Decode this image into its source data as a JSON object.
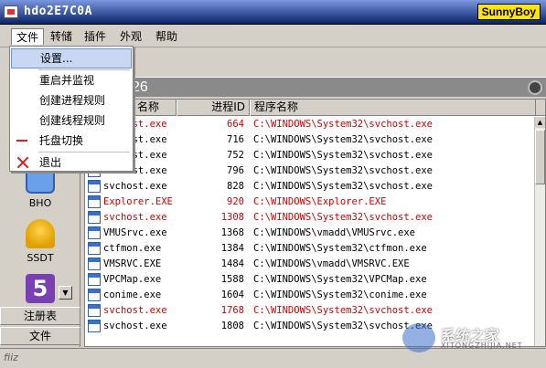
{
  "window": {
    "title": "hdo2E7C0A",
    "brand": "SunnyBoy"
  },
  "menubar": {
    "items": [
      "文件",
      "转储",
      "插件",
      "外观",
      "帮助"
    ]
  },
  "file_menu": {
    "items": [
      {
        "label": "设置...",
        "icon": "",
        "highlighted": true
      },
      {
        "label": "重启并监视",
        "icon": ""
      },
      {
        "label": "创建进程规则",
        "icon": ""
      },
      {
        "label": "创建线程规则",
        "icon": ""
      },
      {
        "label": "托盘切换",
        "icon": "minus-icon"
      },
      {
        "label": "退出",
        "icon": "close-icon"
      }
    ]
  },
  "panel": {
    "title": "26"
  },
  "sidebar": {
    "tools": [
      {
        "label": "BHO",
        "icon": "bho-icon"
      },
      {
        "label": "SSDT",
        "icon": "bell-icon"
      },
      {
        "label": "",
        "icon": "five-icon"
      }
    ],
    "buttons": [
      "注册表",
      "文件"
    ]
  },
  "process_list": {
    "columns": [
      "名称",
      "进程ID",
      "程序名称"
    ],
    "rows": [
      {
        "name": "svchost.exe",
        "pid": "664",
        "path": "C:\\WINDOWS\\System32\\svchost.exe",
        "highlighted": true
      },
      {
        "name": "svchost.exe",
        "pid": "716",
        "path": "C:\\WINDOWS\\System32\\svchost.exe",
        "highlighted": false
      },
      {
        "name": "svchost.exe",
        "pid": "752",
        "path": "C:\\WINDOWS\\System32\\svchost.exe",
        "highlighted": false
      },
      {
        "name": "svchost.exe",
        "pid": "796",
        "path": "C:\\WINDOWS\\System32\\svchost.exe",
        "highlighted": false
      },
      {
        "name": "svchost.exe",
        "pid": "828",
        "path": "C:\\WINDOWS\\System32\\svchost.exe",
        "highlighted": false
      },
      {
        "name": "Explorer.EXE",
        "pid": "920",
        "path": "C:\\WINDOWS\\Explorer.EXE",
        "highlighted": true
      },
      {
        "name": "svchost.exe",
        "pid": "1308",
        "path": "C:\\WINDOWS\\System32\\svchost.exe",
        "highlighted": true
      },
      {
        "name": "VMUSrvc.exe",
        "pid": "1368",
        "path": "C:\\WINDOWS\\vmadd\\VMUSrvc.exe",
        "highlighted": false
      },
      {
        "name": "ctfmon.exe",
        "pid": "1384",
        "path": "C:\\WINDOWS\\System32\\ctfmon.exe",
        "highlighted": false
      },
      {
        "name": "VMSRVC.EXE",
        "pid": "1484",
        "path": "C:\\WINDOWS\\vmadd\\VMSRVC.EXE",
        "highlighted": false
      },
      {
        "name": "VPCMap.exe",
        "pid": "1588",
        "path": "C:\\WINDOWS\\System32\\VPCMap.exe",
        "highlighted": false
      },
      {
        "name": "conime.exe",
        "pid": "1604",
        "path": "C:\\WINDOWS\\System32\\conime.exe",
        "highlighted": false
      },
      {
        "name": "svchost.exe",
        "pid": "1768",
        "path": "C:\\WINDOWS\\System32\\svchost.exe",
        "highlighted": true
      },
      {
        "name": "svchost.exe",
        "pid": "1808",
        "path": "C:\\WINDOWS\\System32\\svchost.exe",
        "highlighted": false
      }
    ]
  },
  "statusbar": {
    "text": "fiiz"
  },
  "watermark": {
    "main": "系统之家",
    "sub": "XITONGZHIJIA.NET"
  },
  "colors": {
    "highlight_text": "#d00000",
    "menu_hover": "#c9d7f2"
  }
}
